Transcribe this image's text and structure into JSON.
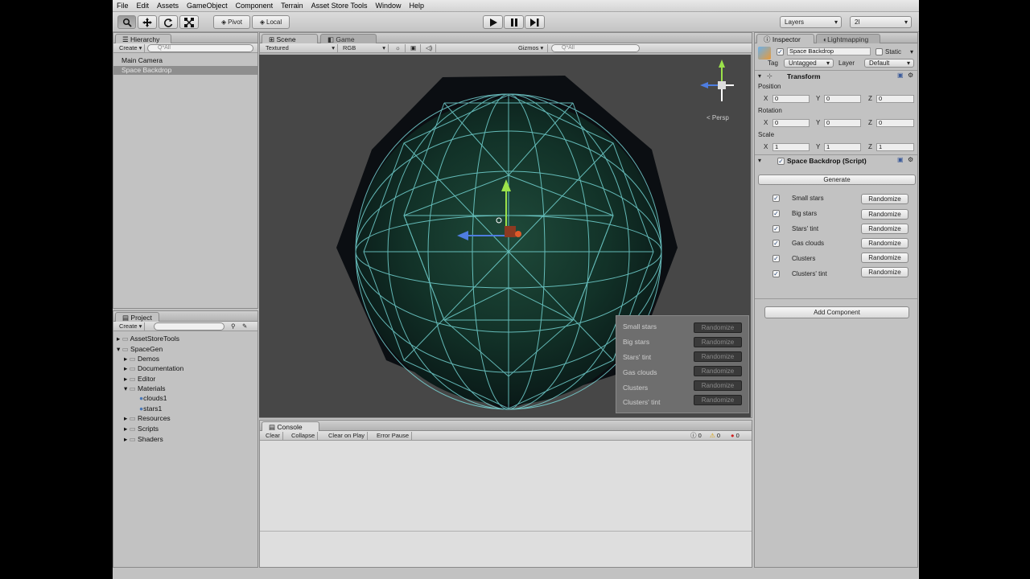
{
  "menu": [
    "File",
    "Edit",
    "Assets",
    "GameObject",
    "Component",
    "Terrain",
    "Asset Store Tools",
    "Window",
    "Help"
  ],
  "toolbar": {
    "pivot": "Pivot",
    "local": "Local",
    "layers": "Layers",
    "layout": "2I"
  },
  "hierarchy": {
    "tab": "Hierarchy",
    "create": "Create",
    "search_placeholder": "Q*All",
    "items": [
      "Main Camera",
      "Space Backdrop"
    ]
  },
  "project": {
    "tab": "Project",
    "create": "Create",
    "items": [
      "AssetStoreTools",
      "SpaceGen",
      "Demos",
      "Documentation",
      "Editor",
      "Materials",
      "clouds1",
      "stars1",
      "Resources",
      "Scripts",
      "Shaders"
    ]
  },
  "scene": {
    "tab_scene": "Scene",
    "tab_game": "Game",
    "render_mode": "Textured",
    "color_mode": "RGB",
    "gizmos": "Gizmos",
    "search_placeholder": "Q*All",
    "persp": "< Persp",
    "overlay_labels": [
      "Small stars",
      "Big stars",
      "Stars' tint",
      "Gas clouds",
      "Clusters",
      "Clusters' tint"
    ],
    "overlay_button": "Randomize"
  },
  "console": {
    "tab": "Console",
    "buttons": [
      "Clear",
      "Collapse",
      "Clear on Play",
      "Error Pause"
    ],
    "counts": [
      "0",
      "0",
      "0"
    ]
  },
  "inspector": {
    "tab": "Inspector",
    "tab2": "Lightmapping",
    "object_name": "Space Backdrop",
    "static": "Static",
    "tag_label": "Tag",
    "tag_value": "Untagged",
    "layer_label": "Layer",
    "layer_value": "Default",
    "transform_title": "Transform",
    "position": "Position",
    "rotation": "Rotation",
    "scale": "Scale",
    "axes": [
      "X",
      "Y",
      "Z"
    ],
    "position_values": [
      "0",
      "0",
      "0"
    ],
    "rotation_values": [
      "0",
      "0",
      "0"
    ],
    "scale_values": [
      "1",
      "1",
      "1"
    ],
    "script_title": "Space Backdrop (Script)",
    "generate": "Generate",
    "rows": [
      "Small stars",
      "Big stars",
      "Stars' tint",
      "Gas clouds",
      "Clusters",
      "Clusters' tint"
    ],
    "randomize": "Randomize",
    "add_component": "Add Component"
  },
  "colors": {
    "editor_bg": "#c2c2c2",
    "scene_bg": "#474747",
    "selection": "#8e8e8e",
    "wire": "#7fe8e8"
  }
}
